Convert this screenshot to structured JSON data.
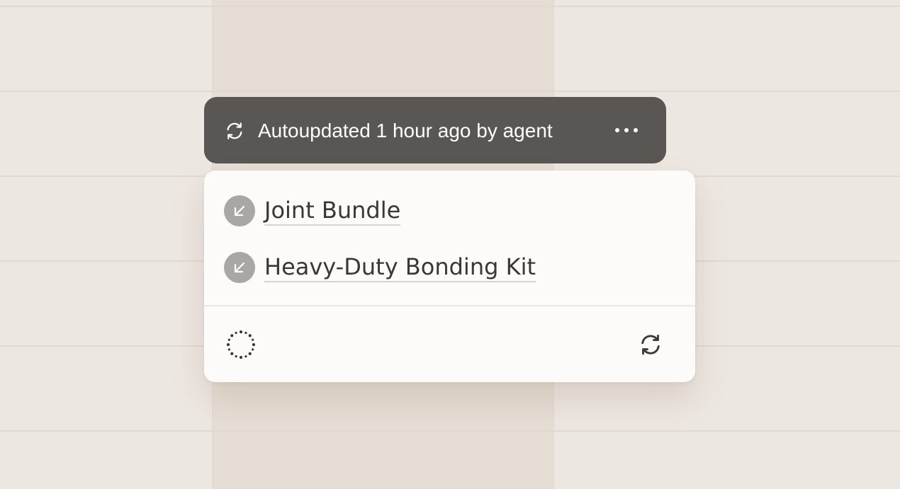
{
  "status_bar": {
    "icon": "refresh-icon",
    "text": "Autoupdated 1 hour ago by agent",
    "more_icon": "more-horizontal-icon"
  },
  "card": {
    "items": [
      {
        "icon": "arrow-down-left-icon",
        "label": "Joint Bundle"
      },
      {
        "icon": "arrow-down-left-icon",
        "label": "Heavy-Duty Bonding Kit"
      }
    ],
    "footer": {
      "left_icon": "loading-spinner-icon",
      "right_icon": "refresh-icon"
    }
  },
  "colors": {
    "background": "#ede7e1",
    "status_bar_bg": "#595653",
    "card_bg": "#fcfbf9",
    "badge_bg": "#a9a6a4",
    "text_dark": "#3a3735"
  }
}
